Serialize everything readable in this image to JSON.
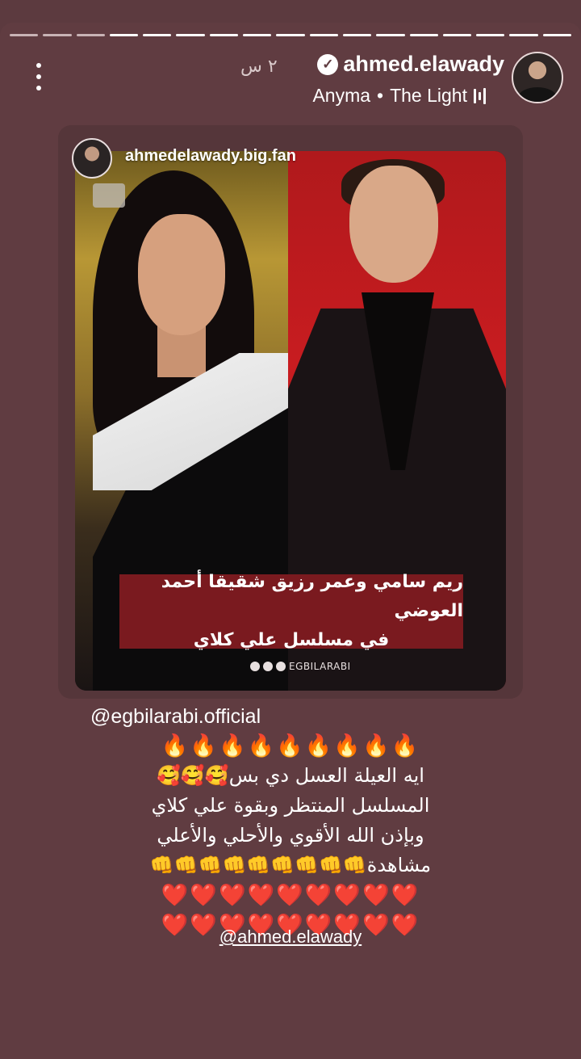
{
  "progress": {
    "segments": 17,
    "seen": 3
  },
  "header": {
    "username": "ahmed.elawady",
    "verified_icon": "✓",
    "time_ago": "٢ س",
    "music": {
      "artist": "Anyma",
      "separator": "•",
      "track": "The Light"
    }
  },
  "shared_post": {
    "username": "ahmedelawady.big.fan",
    "caption_line1": "ريم سامي وعمر رزيق شقيقا أحمد العوضي",
    "caption_line2": "في مسلسل علي كلاي",
    "brand": "EGBILARABI"
  },
  "story_text": {
    "mention_top": "@egbilarabi.official",
    "fire_row": "🔥🔥🔥🔥🔥🔥🔥🔥🔥",
    "line1": "ايه العيلة العسل دي بس🥰🥰🥰",
    "line2": "المسلسل المنتظر وبقوة علي كلاي",
    "line3": "وبإذن الله الأقوي والأحلي والأعلي",
    "line4": "مشاهدة👊👊👊👊👊👊👊👊👊",
    "hearts_row1": "❤️❤️❤️❤️❤️❤️❤️❤️❤️",
    "hearts_row2": "❤️❤️❤️❤️❤️❤️❤️❤️❤️",
    "mention_bottom": "@ahmed.elawady"
  },
  "colors": {
    "background": "#603c41",
    "caption_bg": "#7a1a1f"
  }
}
